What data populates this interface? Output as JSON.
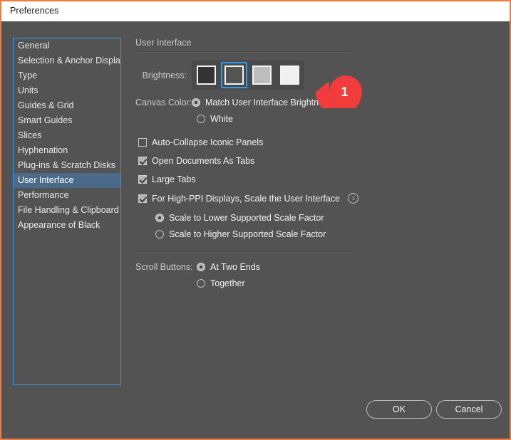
{
  "window": {
    "title": "Preferences",
    "accent_border": "#ef7b3c",
    "background": "#535353",
    "titlebar_background": "#ffffff"
  },
  "sidebar": {
    "selected_index": 9,
    "highlight_color": "#4b6a89",
    "border_color": "#2e9bf0",
    "items": [
      {
        "label": "General"
      },
      {
        "label": "Selection & Anchor Display"
      },
      {
        "label": "Type"
      },
      {
        "label": "Units"
      },
      {
        "label": "Guides & Grid"
      },
      {
        "label": "Smart Guides"
      },
      {
        "label": "Slices"
      },
      {
        "label": "Hyphenation"
      },
      {
        "label": "Plug-ins & Scratch Disks"
      },
      {
        "label": "User Interface"
      },
      {
        "label": "Performance"
      },
      {
        "label": "File Handling & Clipboard"
      },
      {
        "label": "Appearance of Black"
      }
    ]
  },
  "pane": {
    "section_title": "User Interface",
    "brightness": {
      "label": "Brightness:",
      "selected_index": 1,
      "selection_color": "#2e9bf0",
      "swatches": [
        {
          "name": "darkest",
          "color": "#333333"
        },
        {
          "name": "dark",
          "color": "#545454"
        },
        {
          "name": "light",
          "color": "#bdbdbd"
        },
        {
          "name": "lightest",
          "color": "#f0f0f0"
        }
      ]
    },
    "canvas_color": {
      "label": "Canvas Color:",
      "options": [
        {
          "label": "Match User Interface Brightness",
          "selected": true
        },
        {
          "label": "White",
          "selected": false
        }
      ]
    },
    "checkboxes": [
      {
        "label": "Auto-Collapse Iconic Panels",
        "checked": false
      },
      {
        "label": "Open Documents As Tabs",
        "checked": true
      },
      {
        "label": "Large Tabs",
        "checked": true
      },
      {
        "label": "For High-PPI Displays, Scale the User Interface",
        "checked": true,
        "info": "i"
      }
    ],
    "scale_factor": {
      "options": [
        {
          "label": "Scale to Lower Supported Scale Factor",
          "selected": true
        },
        {
          "label": "Scale to Higher Supported Scale Factor",
          "selected": false
        }
      ]
    },
    "scroll_buttons": {
      "label": "Scroll Buttons:",
      "options": [
        {
          "label": "At Two Ends",
          "selected": true
        },
        {
          "label": "Together",
          "selected": false
        }
      ]
    }
  },
  "footer": {
    "ok_label": "OK",
    "cancel_label": "Cancel"
  },
  "callout": {
    "number": "1",
    "color": "#f23b3b"
  }
}
